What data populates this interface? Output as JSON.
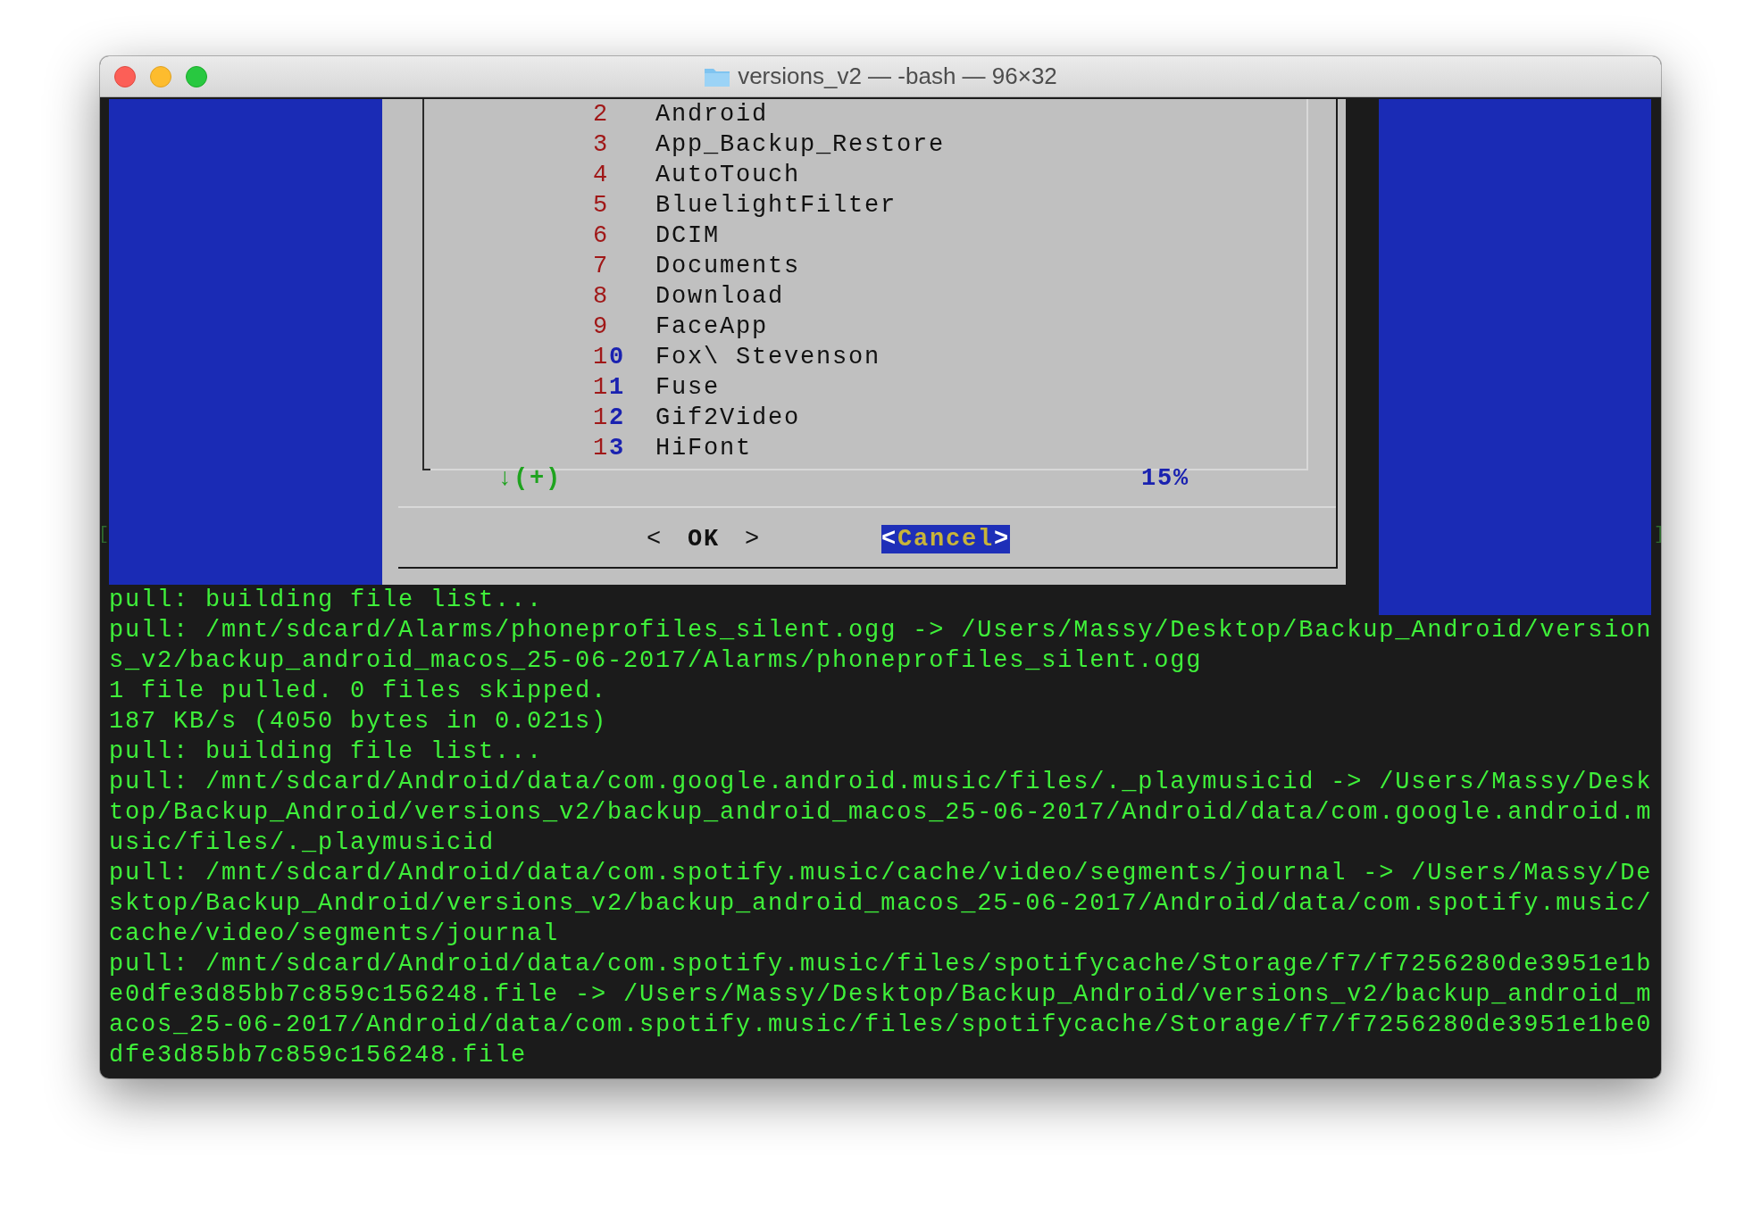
{
  "window": {
    "title": "versions_v2 — -bash — 96×32"
  },
  "dialog": {
    "items": [
      {
        "number": "2",
        "name": "Android"
      },
      {
        "number": "3",
        "name": "App_Backup_Restore"
      },
      {
        "number": "4",
        "name": "AutoTouch"
      },
      {
        "number": "5",
        "name": "BluelightFilter"
      },
      {
        "number": "6",
        "name": "DCIM"
      },
      {
        "number": "7",
        "name": "Documents"
      },
      {
        "number": "8",
        "name": "Download"
      },
      {
        "number": "9",
        "name": "FaceApp"
      },
      {
        "number": "1",
        "number_hotkey": "0",
        "name": "Fox\\ Stevenson"
      },
      {
        "number": "1",
        "number_hotkey": "1",
        "name": "Fuse"
      },
      {
        "number": "1",
        "number_hotkey": "2",
        "name": "Gif2Video"
      },
      {
        "number": "1",
        "number_hotkey": "3",
        "name": "HiFont"
      }
    ],
    "more_indicator": "↓(+)",
    "scroll_percent": "15%",
    "buttons": [
      {
        "left": "<",
        "label": "OK",
        "right": ">",
        "selected": false
      },
      {
        "left": "<",
        "label": "Cancel",
        "right": ">",
        "selected": true
      }
    ]
  },
  "side_marks": {
    "left": "[",
    "right": "]"
  },
  "output": [
    "pull: building file list...",
    "pull: /mnt/sdcard/Alarms/phoneprofiles_silent.ogg -> /Users/Massy/Desktop/Backup_Android/versions_v2/backup_android_macos_25-06-2017/Alarms/phoneprofiles_silent.ogg",
    "1 file pulled. 0 files skipped.",
    "187 KB/s (4050 bytes in 0.021s)",
    "pull: building file list...",
    "pull: /mnt/sdcard/Android/data/com.google.android.music/files/._playmusicid -> /Users/Massy/Desktop/Backup_Android/versions_v2/backup_android_macos_25-06-2017/Android/data/com.google.android.music/files/._playmusicid",
    "pull: /mnt/sdcard/Android/data/com.spotify.music/cache/video/segments/journal -> /Users/Massy/Desktop/Backup_Android/versions_v2/backup_android_macos_25-06-2017/Android/data/com.spotify.music/cache/video/segments/journal",
    "pull: /mnt/sdcard/Android/data/com.spotify.music/files/spotifycache/Storage/f7/f7256280de3951e1be0dfe3d85bb7c859c156248.file -> /Users/Massy/Desktop/Backup_Android/versions_v2/backup_android_macos_25-06-2017/Android/data/com.spotify.music/files/spotifycache/Storage/f7/f7256280de3951e1be0dfe3d85bb7c859c156248.file"
  ]
}
